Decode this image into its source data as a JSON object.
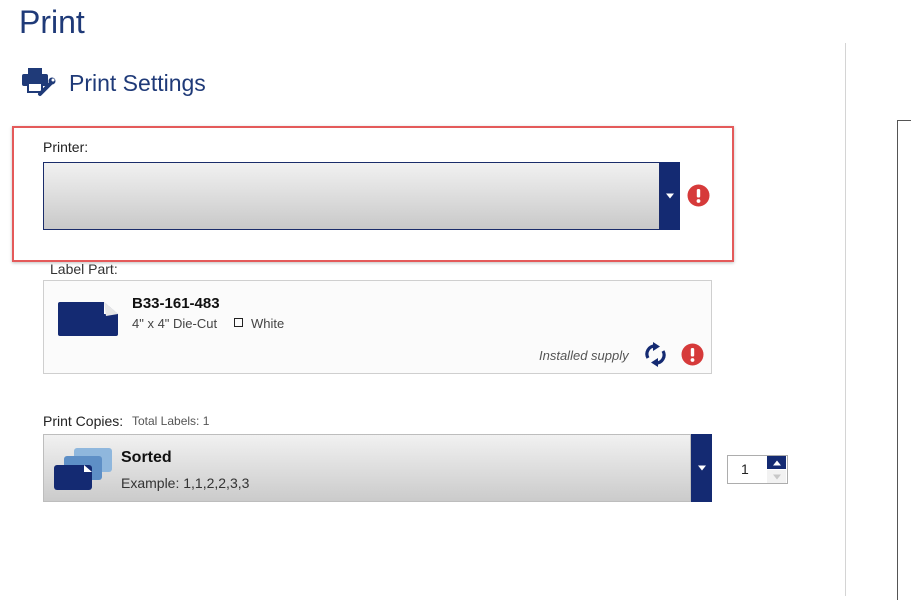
{
  "page": {
    "title": "Print"
  },
  "settings_section": {
    "title": "Print Settings",
    "icon": "printer-settings-icon"
  },
  "printer": {
    "label": "Printer:",
    "selected": "",
    "status_icon": "error-icon"
  },
  "label_part": {
    "label": "Label Part:",
    "part_number": "B33-161-483",
    "size_type": "4\" x 4\"  Die-Cut",
    "color": "White",
    "supply_status": "Installed supply",
    "refresh_icon": "refresh-icon",
    "status_icon": "error-icon"
  },
  "print_copies": {
    "label": "Print Copies:",
    "total_labels": "Total Labels: 1",
    "collation": "Sorted",
    "example": "Example: 1,1,2,2,3,3",
    "count": "1"
  },
  "colors": {
    "accent": "#142a72",
    "title": "#1f3a78",
    "error": "#d63a3a",
    "highlight": "#e45a5a"
  }
}
